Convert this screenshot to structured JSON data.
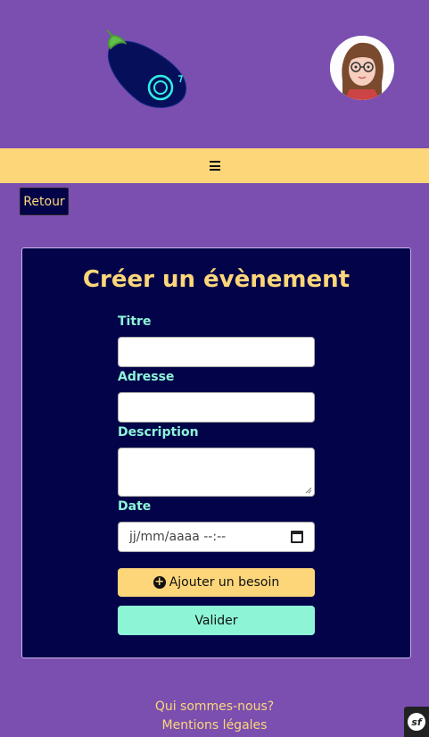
{
  "header": {
    "logo": "eggplant-logo",
    "avatar": "user-avatar"
  },
  "navbar": {
    "menu_icon": "hamburger-icon"
  },
  "back_button": "Retour",
  "form": {
    "title": "Créer un évènement",
    "fields": {
      "title_label": "Titre",
      "address_label": "Adresse",
      "description_label": "Description",
      "date_label": "Date",
      "date_placeholder": "jj/mm/aaaa --:--"
    },
    "add_need_label": "Ajouter un besoin",
    "submit_label": "Valider"
  },
  "footer": {
    "about_link": "Qui sommes-nous?",
    "legal_link": "Mentions légales"
  },
  "colors": {
    "background": "#7a4fb0",
    "accent_yellow": "#fcd679",
    "accent_mint": "#8df5d6",
    "card_bg": "#03034a"
  }
}
